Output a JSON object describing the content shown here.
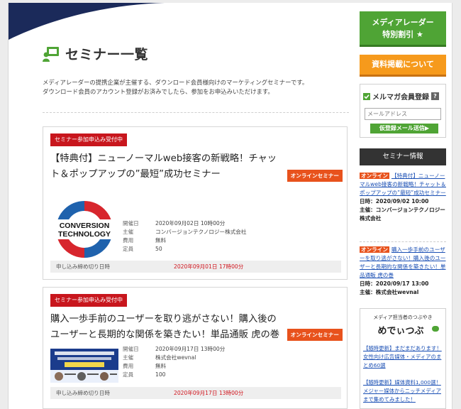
{
  "main": {
    "page_title": "セミナー一覧",
    "intro_line1": "メディアレーダーの提携企業が主催する、ダウンロード会員様向けのマーケティングセミナーです。",
    "intro_line2": "ダウンロード会員のアカウント登録がお済みでしたら、参加をお申込みいただけます。",
    "labels": {
      "date": "開催日",
      "host": "主催",
      "fee": "費用",
      "capacity": "定員",
      "deadline": "申し込み締め切り日時"
    },
    "seminars": [
      {
        "status_badge": "セミナー参加申込み受付中",
        "title": "【特典付】ニューノーマルweb接客の新戦略！チャット＆ポップアップの”最短”成功セミナー",
        "online_badge": "オンラインセミナー",
        "logo_text_1": "CONVERSION",
        "logo_text_2": "TECHNOLOGY",
        "date": "2020年09月02日 10時00分",
        "host": "コンバージョンテクノロジー株式会社",
        "fee": "無料",
        "capacity": "50",
        "deadline": "2020年09月01日 17時00分"
      },
      {
        "status_badge": "セミナー参加申込み受付中",
        "title": "購入一歩手前のユーザーを取り逃がさない！購入後のユーザーと長期的な関係を築きたい！単品通販 虎の巻",
        "online_badge": "オンラインセミナー",
        "date": "2020年09月17日 13時00分",
        "host": "株式会社wevnal",
        "fee": "無料",
        "capacity": "100",
        "deadline": "2020年09月17日 13時00分"
      }
    ]
  },
  "sidebar": {
    "discount_line1": "メディアレーダー",
    "discount_line2": "特別割引 ★",
    "listing_button": "資料掲載について",
    "mailmag_title": "メルマガ会員登録",
    "help_mark": "?",
    "email_placeholder": "メールアドレス",
    "register_button": "仮登録メール送信▶",
    "seminar_info_header": "セミナー情報",
    "seminar_items": [
      {
        "online": "オンライン",
        "title": "【特典付】ニューノーマルweb接客の新戦略！チャット＆ポップアップの”最短”成功セミナー",
        "datetime": "日時：2020/09/02 10:00",
        "host": "主催：コンバージョンテクノロジー株式会社"
      },
      {
        "online": "オンライン",
        "title": "購入一歩手前のユーザーを取り逃がさない！購入後のユーザーと長期的な関係を築きたい！単品通販 虎の巻",
        "datetime": "日時：2020/09/17 13:00",
        "host": "主催：株式会社wevnal"
      }
    ],
    "metsubu_caption": "メディア担当者のつぶやき",
    "metsubu_logo": "めでぃつぶ",
    "metsubu_items": [
      "【随時更新】まだまだあります！女性向け広告媒体・メディアのまとめ60選",
      "【随時更新】媒体資料1,000選！メジャー媒体からニッチメディアまで集めてみました！"
    ]
  },
  "colors": {
    "accent_red": "#c8161d",
    "online_orange": "#e8521c",
    "green": "#4fa435",
    "orange": "#f69a1c",
    "navy": "#1b2a5a"
  }
}
